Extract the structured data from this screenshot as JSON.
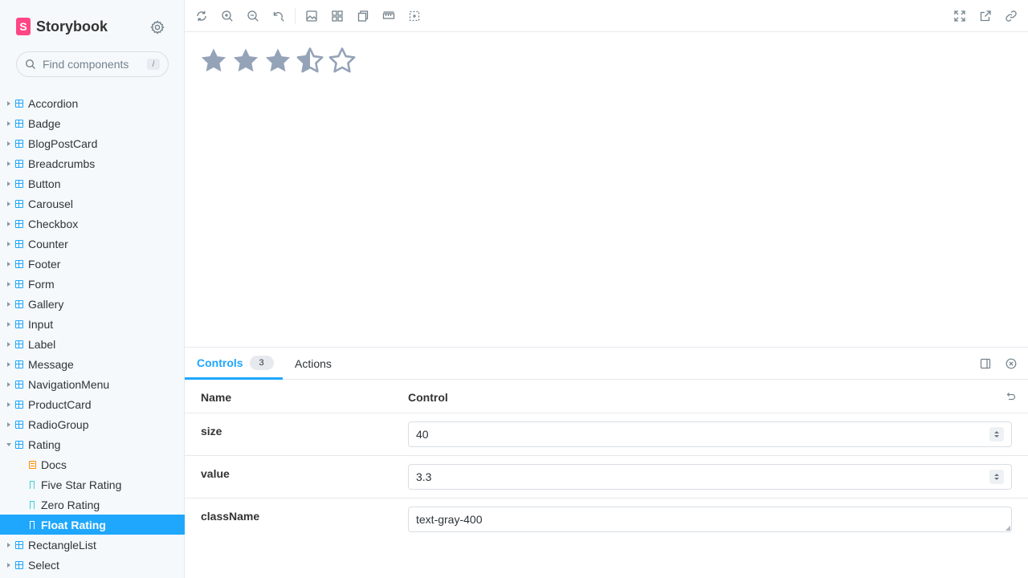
{
  "brand": {
    "name": "Storybook",
    "logo_letter": "S",
    "accent": "#ff4785"
  },
  "search": {
    "placeholder": "Find components",
    "shortcut": "/"
  },
  "sidebar": {
    "selected_color": "#1ea7fd",
    "items": [
      {
        "label": "Accordion"
      },
      {
        "label": "Badge"
      },
      {
        "label": "BlogPostCard"
      },
      {
        "label": "Breadcrumbs"
      },
      {
        "label": "Button"
      },
      {
        "label": "Carousel"
      },
      {
        "label": "Checkbox"
      },
      {
        "label": "Counter"
      },
      {
        "label": "Footer"
      },
      {
        "label": "Form"
      },
      {
        "label": "Gallery"
      },
      {
        "label": "Input"
      },
      {
        "label": "Label"
      },
      {
        "label": "Message"
      },
      {
        "label": "NavigationMenu"
      },
      {
        "label": "ProductCard"
      },
      {
        "label": "RadioGroup"
      },
      {
        "label": "Rating"
      },
      {
        "label": "RectangleList"
      },
      {
        "label": "Select"
      }
    ],
    "rating_children": [
      {
        "label": "Docs",
        "type": "doc"
      },
      {
        "label": "Five Star Rating",
        "type": "story"
      },
      {
        "label": "Zero Rating",
        "type": "story"
      },
      {
        "label": "Float Rating",
        "type": "story",
        "selected": true
      }
    ]
  },
  "toolbar": {
    "left_icons": [
      "reload-icon",
      "zoom-in-icon",
      "zoom-out-icon",
      "zoom-reset-icon",
      "background-icon",
      "grid-icon",
      "viewport-icon",
      "measure-icon",
      "outline-icon"
    ],
    "right_icons": [
      "fullscreen-icon",
      "open-new-tab-icon",
      "copy-link-icon"
    ]
  },
  "preview": {
    "rating_value": 3.3,
    "max_stars": 5,
    "star_color": "#94a3b8"
  },
  "panel": {
    "tabs": [
      {
        "label": "Controls",
        "count": "3",
        "active": true
      },
      {
        "label": "Actions"
      }
    ],
    "columns": {
      "name": "Name",
      "control": "Control"
    },
    "rows": [
      {
        "name": "size",
        "value": "40",
        "kind": "number"
      },
      {
        "name": "value",
        "value": "3.3",
        "kind": "number"
      },
      {
        "name": "className",
        "value": "text-gray-400",
        "kind": "text"
      }
    ]
  }
}
